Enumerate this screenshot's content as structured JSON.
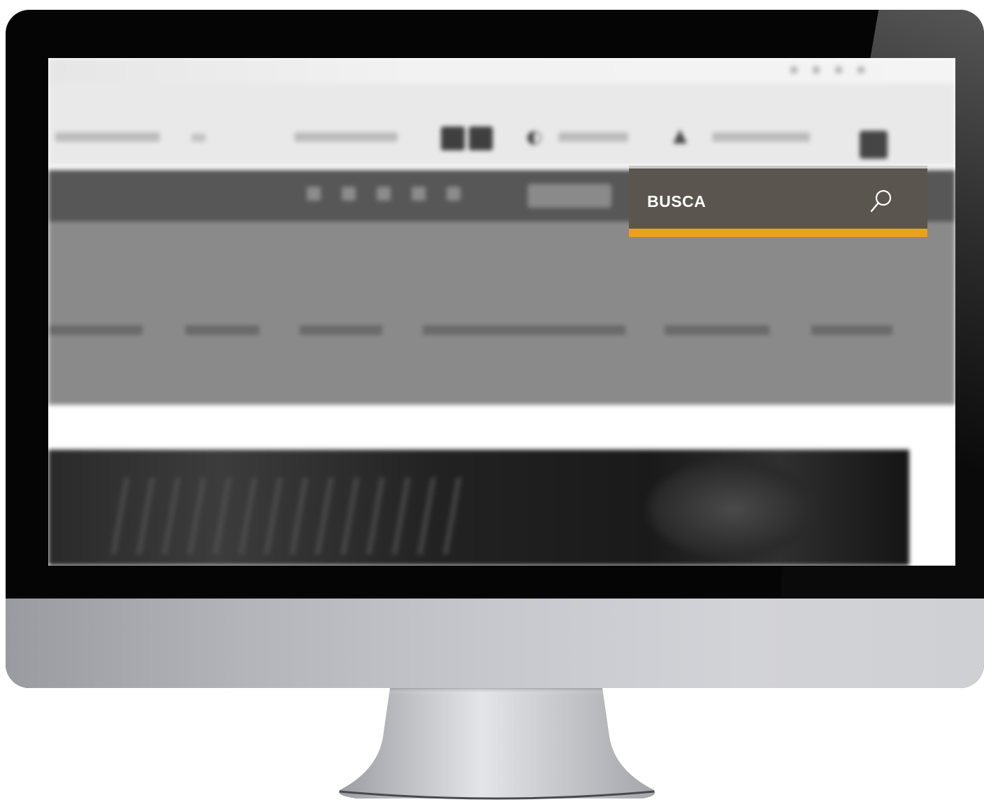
{
  "search": {
    "label": "BUSCA",
    "icon": "search-icon",
    "accent_color": "#e8a21c",
    "box_color": "#5a554e"
  },
  "colors": {
    "nav_background": "#8a8a8a",
    "dark_bar": "#575757",
    "monitor_frame": "#050505"
  }
}
